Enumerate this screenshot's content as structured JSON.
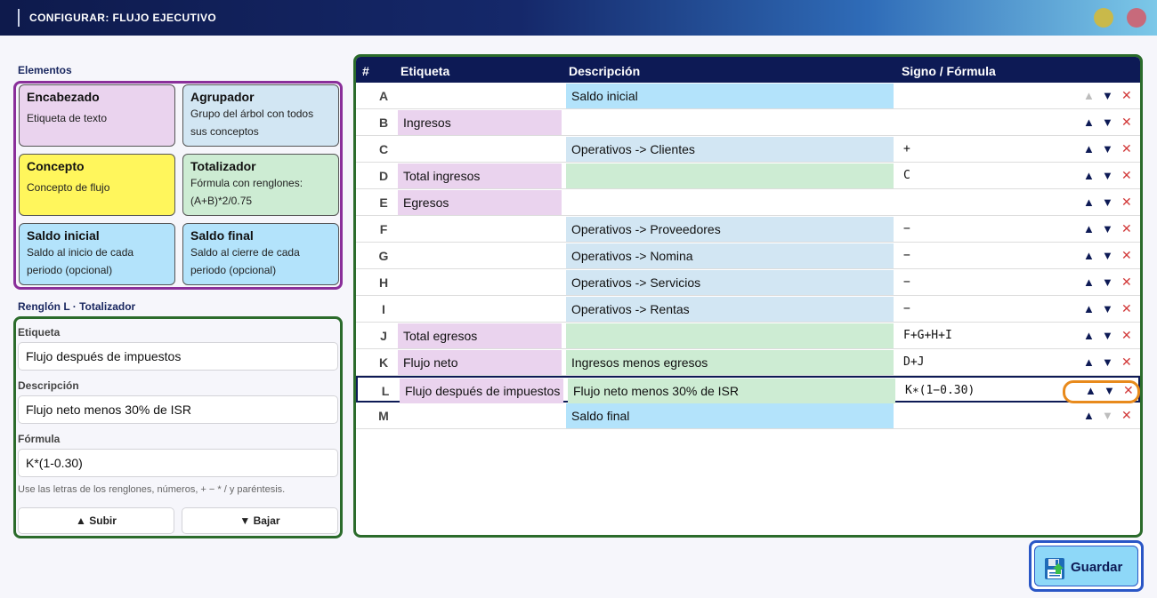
{
  "window": {
    "title": "CONFIGURAR: FLUJO EJECUTIVO"
  },
  "elements_panel": {
    "title": "Elementos",
    "cards": [
      {
        "name": "Encabezado",
        "desc": "Etiqueta de texto"
      },
      {
        "name": "Agrupador",
        "desc": "Grupo del árbol con todos sus conceptos"
      },
      {
        "name": "Concepto",
        "desc": "Concepto de flujo"
      },
      {
        "name": "Totalizador",
        "desc": "Fórmula con renglones: (A+B)*2/0.75"
      },
      {
        "name": "Saldo inicial",
        "desc": "Saldo al inicio de cada periodo (opcional)"
      },
      {
        "name": "Saldo final",
        "desc": "Saldo al cierre de cada periodo (opcional)"
      }
    ]
  },
  "editor": {
    "title": "Renglón L · Totalizador",
    "etiqueta_label": "Etiqueta",
    "etiqueta_value": "Flujo después de impuestos",
    "descripcion_label": "Descripción",
    "descripcion_value": "Flujo neto menos 30% de ISR",
    "formula_label": "Fórmula",
    "formula_value": "K*(1-0.30)",
    "hint": "Use las letras de los renglones, números, + − * / y paréntesis.",
    "up_label": "▲ Subir",
    "down_label": "▼ Bajar"
  },
  "table": {
    "columns": [
      "#",
      "Etiqueta",
      "Descripción",
      "Signo / Fórmula"
    ],
    "rows": [
      {
        "id": "A",
        "label": "",
        "desc": "Saldo inicial",
        "sign": "",
        "kind": "saldo"
      },
      {
        "id": "B",
        "label": "Ingresos",
        "desc": "",
        "sign": "",
        "kind": "header"
      },
      {
        "id": "C",
        "label": "",
        "desc": "Operativos -> Clientes",
        "sign": "+",
        "kind": "group"
      },
      {
        "id": "D",
        "label": "Total ingresos",
        "desc": "",
        "sign": "C",
        "kind": "total"
      },
      {
        "id": "E",
        "label": "Egresos",
        "desc": "",
        "sign": "",
        "kind": "header"
      },
      {
        "id": "F",
        "label": "",
        "desc": "Operativos -> Proveedores",
        "sign": "−",
        "kind": "group"
      },
      {
        "id": "G",
        "label": "",
        "desc": "Operativos -> Nomina",
        "sign": "−",
        "kind": "group"
      },
      {
        "id": "H",
        "label": "",
        "desc": "Operativos -> Servicios",
        "sign": "−",
        "kind": "group"
      },
      {
        "id": "I",
        "label": "",
        "desc": "Operativos -> Rentas",
        "sign": "−",
        "kind": "group"
      },
      {
        "id": "J",
        "label": "Total egresos",
        "desc": "",
        "sign": "F+G+H+I",
        "kind": "total"
      },
      {
        "id": "K",
        "label": "Flujo neto",
        "desc": "Ingresos menos egresos",
        "sign": "D+J",
        "kind": "total"
      },
      {
        "id": "L",
        "label": "Flujo después de impuestos",
        "desc": "Flujo neto menos 30% de ISR",
        "sign": "K∗(1−0.30)",
        "kind": "total"
      },
      {
        "id": "M",
        "label": "",
        "desc": "Saldo final",
        "sign": "",
        "kind": "saldo"
      }
    ],
    "action_icons": {
      "up": "▲",
      "down": "▼",
      "delete": "✕"
    },
    "selected_row": "L"
  },
  "save_button": {
    "label": "Guardar",
    "icon": "floppy-disk-icon"
  }
}
